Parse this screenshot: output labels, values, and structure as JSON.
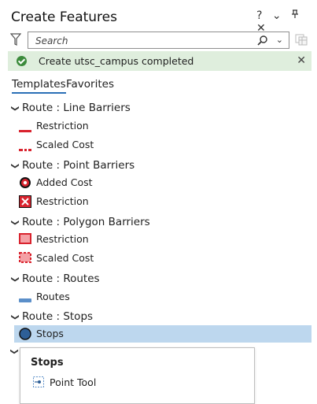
{
  "window": {
    "title": "Create Features",
    "controls": {
      "help": "?",
      "menu": "⌄",
      "pin": "ᚑ",
      "close": "✕"
    }
  },
  "search": {
    "placeholder": "Search",
    "value": ""
  },
  "banner": {
    "message": "Create utsc_campus completed",
    "close": "✕",
    "accent": "#3c8b3c",
    "background": "#dfeedd"
  },
  "tabs": [
    {
      "label": "Templates",
      "active": true
    },
    {
      "label": "Favorites",
      "active": false
    }
  ],
  "groups": [
    {
      "label": "Route : Line Barriers",
      "items": [
        {
          "label": "Restriction",
          "symbol": "line-solid-red"
        },
        {
          "label": "Scaled Cost",
          "symbol": "line-dashed-red"
        }
      ]
    },
    {
      "label": "Route : Point Barriers",
      "items": [
        {
          "label": "Added Cost",
          "symbol": "point-ring-red"
        },
        {
          "label": "Restriction",
          "symbol": "point-x-red"
        }
      ]
    },
    {
      "label": "Route : Polygon Barriers",
      "items": [
        {
          "label": "Restriction",
          "symbol": "polygon-solid-red"
        },
        {
          "label": "Scaled Cost",
          "symbol": "polygon-dashed-red"
        }
      ]
    },
    {
      "label": "Route : Routes",
      "items": [
        {
          "label": "Routes",
          "symbol": "line-blue"
        }
      ]
    },
    {
      "label": "Route : Stops",
      "items": [
        {
          "label": "Stops",
          "symbol": "point-blue",
          "selected": true
        }
      ]
    }
  ],
  "popup": {
    "title": "Stops",
    "tool_label": "Point Tool"
  },
  "colors": {
    "selection": "#bdd7ee",
    "tab_underline": "#2a6fb6",
    "barrier_red": "#d9232e",
    "route_blue": "#5b8fc9"
  }
}
